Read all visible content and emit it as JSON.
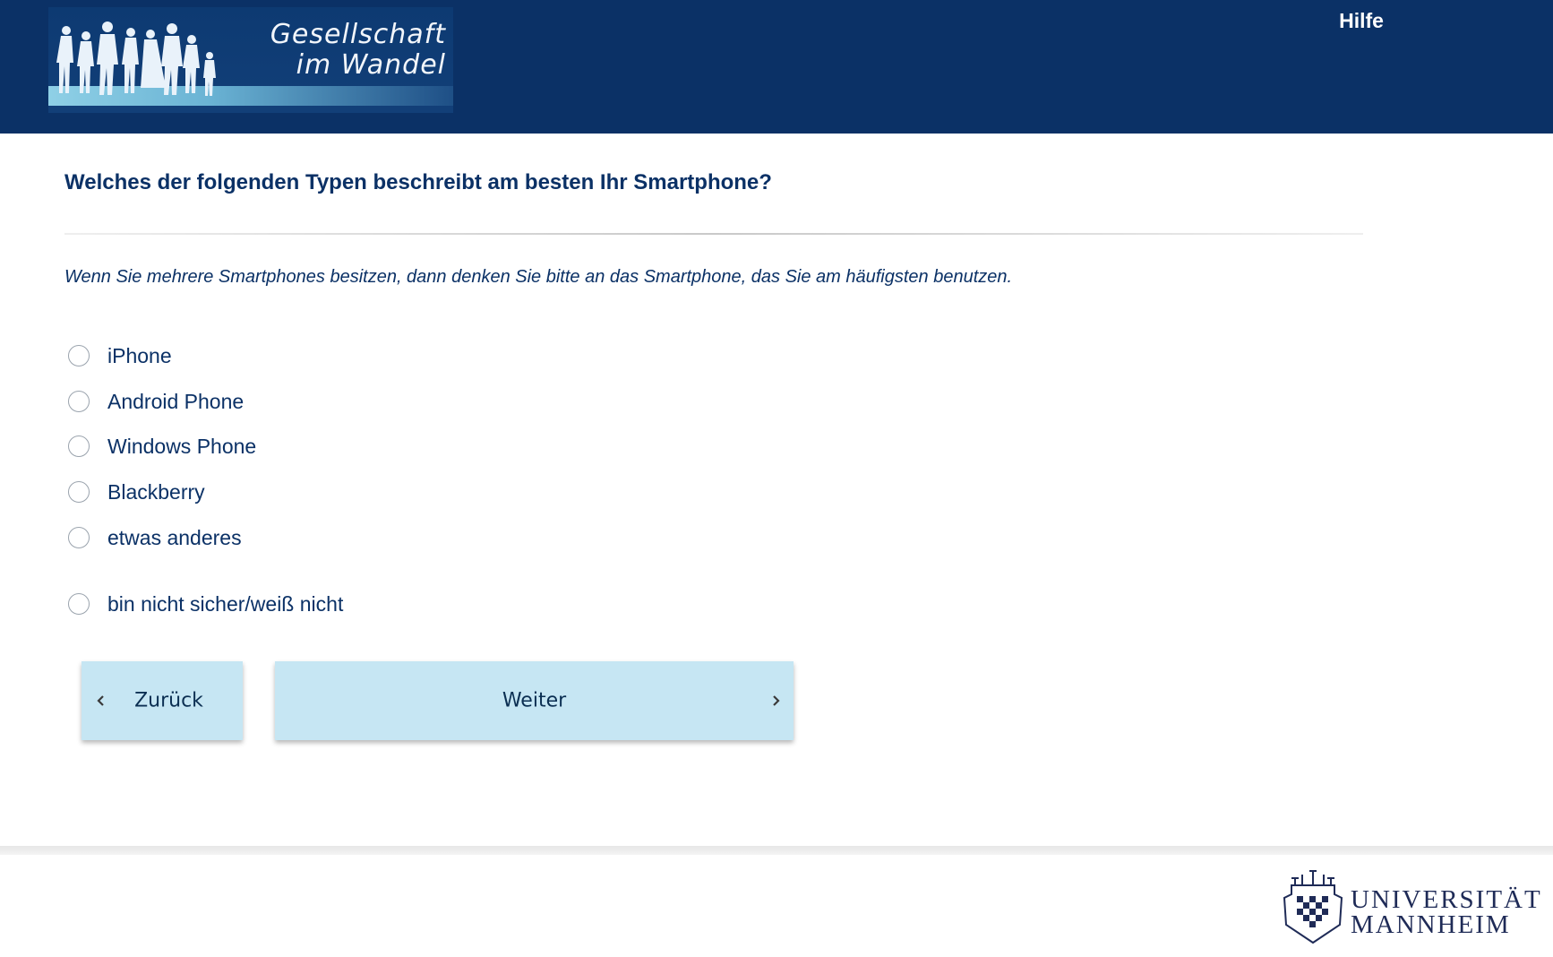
{
  "header": {
    "logo_line1": "Gesellschaft",
    "logo_line2": "im Wandel",
    "help_label": "Hilfe",
    "background_color": "#0b3166"
  },
  "question": {
    "title": "Welches der folgenden Typen beschreibt am besten Ihr Smartphone?",
    "instruction": "Wenn Sie mehrere Smartphones besitzen, dann denken Sie bitte an das Smartphone, das Sie am häufigsten benutzen.",
    "options": [
      {
        "label": "iPhone",
        "selected": false
      },
      {
        "label": "Android Phone",
        "selected": false
      },
      {
        "label": "Windows Phone",
        "selected": false
      },
      {
        "label": "Blackberry",
        "selected": false
      },
      {
        "label": "etwas anderes",
        "selected": false
      },
      {
        "label": "bin nicht sicher/weiß nicht",
        "selected": false
      }
    ]
  },
  "navigation": {
    "back_label": "Zurück",
    "next_label": "Weiter",
    "button_color": "#c6e6f3"
  },
  "footer": {
    "university_line1": "UNIVERSITÄT",
    "university_line2": "MANNHEIM"
  },
  "icons": {
    "back": "chevron-left-icon",
    "next": "chevron-right-icon",
    "crest": "university-crest-icon"
  }
}
